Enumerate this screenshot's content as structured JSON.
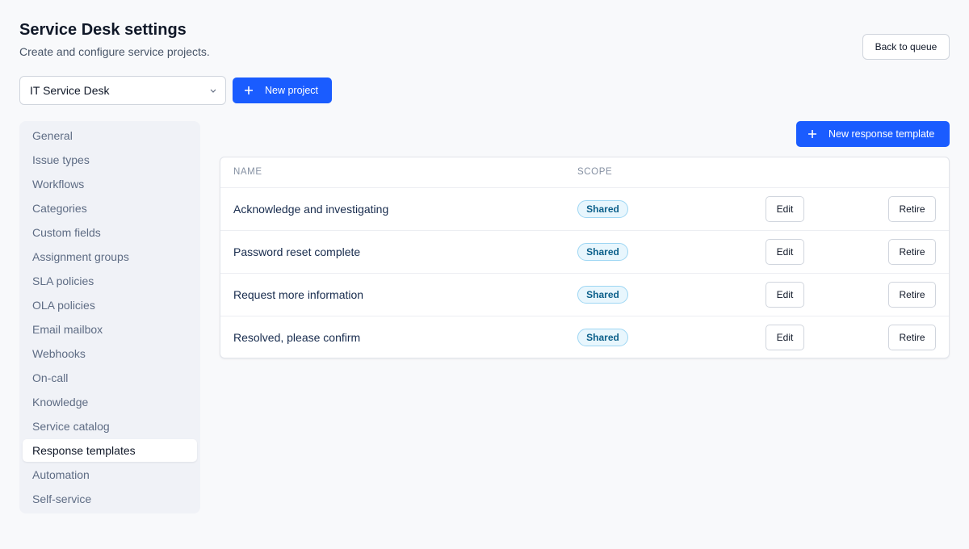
{
  "header": {
    "title": "Service Desk settings",
    "subtitle": "Create and configure service projects.",
    "back_label": "Back to queue"
  },
  "project_select": {
    "value": "IT Service Desk"
  },
  "actions": {
    "new_project_label": "New project",
    "new_template_label": "New response template"
  },
  "sidebar": {
    "items": [
      {
        "label": "General"
      },
      {
        "label": "Issue types"
      },
      {
        "label": "Workflows"
      },
      {
        "label": "Categories"
      },
      {
        "label": "Custom fields"
      },
      {
        "label": "Assignment groups"
      },
      {
        "label": "SLA policies"
      },
      {
        "label": "OLA policies"
      },
      {
        "label": "Email mailbox"
      },
      {
        "label": "Webhooks"
      },
      {
        "label": "On-call"
      },
      {
        "label": "Knowledge"
      },
      {
        "label": "Service catalog"
      },
      {
        "label": "Response templates",
        "active": true
      },
      {
        "label": "Automation"
      },
      {
        "label": "Self-service"
      }
    ]
  },
  "table": {
    "columns": {
      "name": "NAME",
      "scope": "SCOPE"
    },
    "rows": [
      {
        "name": "Acknowledge and investigating",
        "scope": "Shared",
        "edit": "Edit",
        "retire": "Retire"
      },
      {
        "name": "Password reset complete",
        "scope": "Shared",
        "edit": "Edit",
        "retire": "Retire"
      },
      {
        "name": "Request more information",
        "scope": "Shared",
        "edit": "Edit",
        "retire": "Retire"
      },
      {
        "name": "Resolved, please confirm",
        "scope": "Shared",
        "edit": "Edit",
        "retire": "Retire"
      }
    ]
  },
  "colors": {
    "primary": "#1a5cff",
    "badge_bg": "#e8f6fd",
    "badge_text": "#0b5f8a"
  },
  "icons": {
    "plus": "plus-icon",
    "chevron": "chevron-down-icon"
  }
}
